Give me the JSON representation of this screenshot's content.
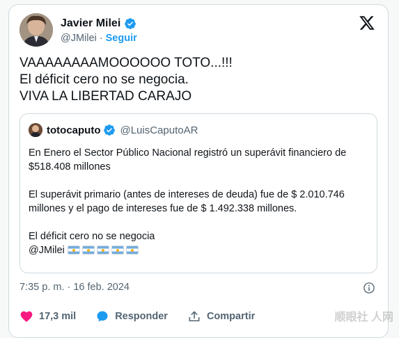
{
  "author": {
    "name": "Javier Milei",
    "handle": "@JMilei",
    "separator": "·",
    "follow_label": "Seguir"
  },
  "tweet_lines": [
    "VAAAAAAAAMOOOOOO TOTO...!!!",
    "El déficit cero no se negocia.",
    "VIVA LA LIBERTAD CARAJO"
  ],
  "quoted": {
    "name": "totocaputo",
    "handle": "@LuisCaputoAR",
    "paragraph1": "En Enero el Sector Público Nacional registró un superávit financiero de $518.408 millones",
    "paragraph2": "El superávit primario (antes de intereses de deuda) fue de $ 2.010.746 millones y el pago de intereses fue de $ 1.492.338 millones.",
    "paragraph3": "El déficit cero no se negocia",
    "mention": "@JMilei",
    "flag_count": 5
  },
  "timestamp": "7:35 p. m. · 16 feb. 2024",
  "actions": {
    "likes": "17,3 mil",
    "reply_label": "Responder",
    "share_label": "Compartir"
  },
  "watermark": "顺眼社 人网",
  "colors": {
    "accent": "#1d9bf0",
    "like": "#f91880",
    "text": "#0f1419",
    "muted": "#536471"
  },
  "icons": [
    "verified-badge-icon",
    "x-logo-icon",
    "info-icon",
    "heart-icon",
    "reply-icon",
    "share-icon",
    "argentina-flag-icon"
  ]
}
